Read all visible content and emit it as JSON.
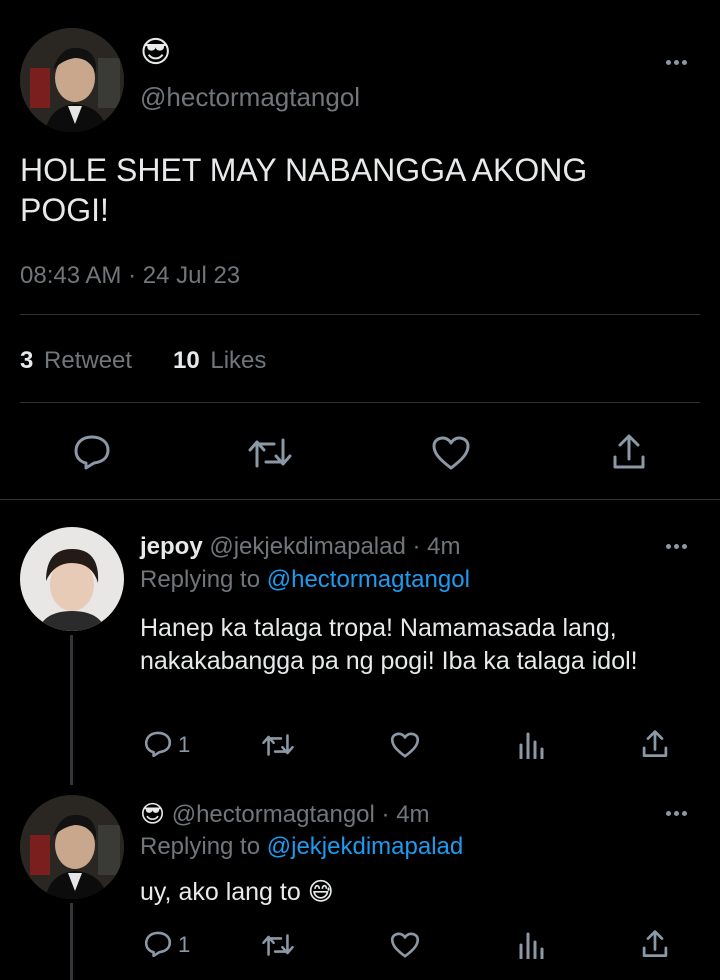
{
  "main_tweet": {
    "display_name_emoji": "😎",
    "handle": "@hectormagtangol",
    "text": "HOLE SHET MAY NABANGGA AKONG POGI!",
    "timestamp": "08:43 AM · 24 Jul 23",
    "retweets_count": "3",
    "retweets_label": "Retweet",
    "likes_count": "10",
    "likes_label": "Likes"
  },
  "replies": [
    {
      "display_name": "jepoy",
      "handle": "@jekjekdimapalad",
      "time": "· 4m",
      "replying_to_label": "Replying to",
      "replying_to_handle": "@hectormagtangol",
      "text": "Hanep ka talaga tropa! Namamasada lang, nakakabangga pa ng pogi! Iba ka talaga idol!",
      "reply_count": "1"
    },
    {
      "display_name": "😎",
      "handle": "@hectormagtangol",
      "time": "· 4m",
      "replying_to_label": "Replying to",
      "replying_to_handle": "@jekjekdimapalad",
      "text": "uy, ako lang to 😅",
      "reply_count": "1"
    }
  ],
  "colors": {
    "background": "#000000",
    "text": "#e7e9ea",
    "muted": "#71767b",
    "link": "#1d9bf0",
    "divider": "#2f3336"
  },
  "icons": [
    "more-icon",
    "reply-icon",
    "retweet-icon",
    "like-icon",
    "share-icon",
    "analytics-icon"
  ]
}
